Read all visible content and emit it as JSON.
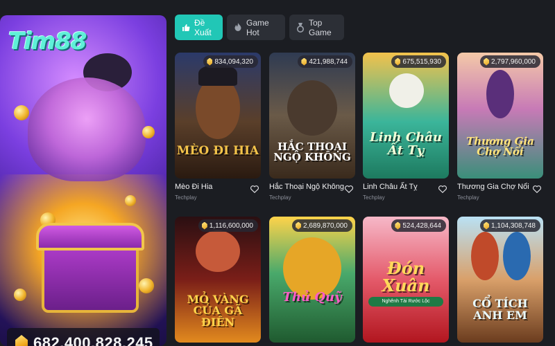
{
  "brand": {
    "logo_text": "Tim88"
  },
  "hero": {
    "jackpot_value": "682,400,828,245"
  },
  "tabs": [
    {
      "label": "Đề Xuất",
      "icon": "thumbs-up-icon",
      "active": true
    },
    {
      "label": "Game Hot",
      "icon": "fire-icon",
      "active": false
    },
    {
      "label": "Top Game",
      "icon": "medal-icon",
      "active": false
    }
  ],
  "games": [
    {
      "jackpot": "834,094,320",
      "art_title": "MÈO ĐI HIA",
      "name": "Mèo Đi Hia",
      "provider": "Techplay"
    },
    {
      "jackpot": "421,988,744",
      "art_title": "HẮC THOẠI NGỘ KHÔNG",
      "name": "Hắc Thoại Ngộ Không",
      "provider": "Techplay"
    },
    {
      "jackpot": "675,515,930",
      "art_title": "Linh Châu Ất Tỵ",
      "name": "Linh Châu Ất Tỵ",
      "provider": "Techplay"
    },
    {
      "jackpot": "2,797,960,000",
      "art_title": "Thương Gia Chợ Nổi",
      "name": "Thương Gia Chợ Nổi",
      "provider": "Techplay"
    },
    {
      "jackpot": "1,116,600,000",
      "art_title": "MỎ VÀNG CỦA GÃ ĐIÊN",
      "name": "",
      "provider": ""
    },
    {
      "jackpot": "2,689,870,000",
      "art_title": "Thủ Quỹ",
      "name": "",
      "provider": ""
    },
    {
      "jackpot": "524,428,644",
      "art_title": "Đón Xuân",
      "art_subtitle": "Nghênh Tài Rước Lộc",
      "name": "",
      "provider": ""
    },
    {
      "jackpot": "1,104,308,748",
      "art_title": "CỔ TÍCH ANH EM",
      "name": "",
      "provider": ""
    }
  ],
  "colors": {
    "accent": "#21c7b6",
    "background": "#1b1d22",
    "tab_bg": "#2c2f36"
  }
}
